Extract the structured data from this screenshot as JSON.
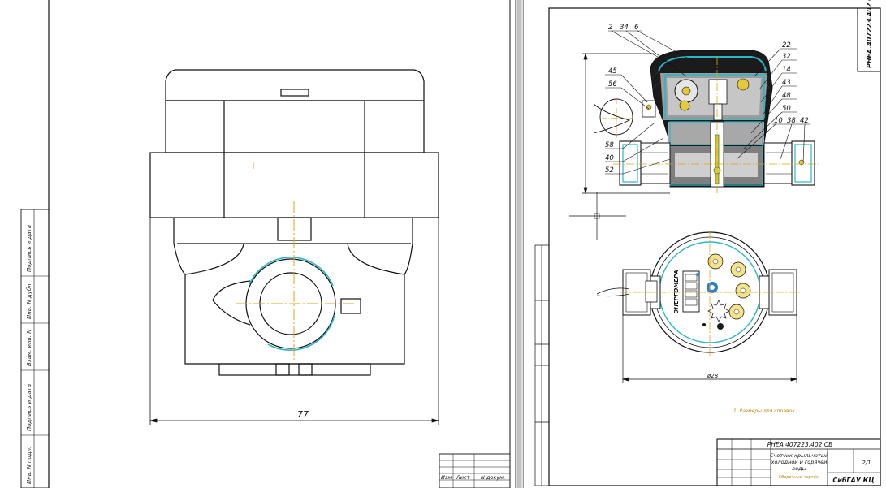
{
  "left_sheet": {
    "dimension": "77",
    "side_stamp": [
      "Подпись и дата",
      "Инв. N дубл.",
      "Взам. инв. N",
      "Подпись и дата",
      "Инв. N подл."
    ],
    "title_cells": [
      "Изм",
      "Лист",
      "N докум."
    ]
  },
  "right_sheet": {
    "doc_code_vertical": "РНЕА.407223.402 СБ",
    "callouts_top": [
      "2",
      "34",
      "6"
    ],
    "callouts_right": [
      "22",
      "32",
      "14",
      "43",
      "48",
      "50",
      "10",
      "38",
      "42"
    ],
    "callouts_left": [
      "45",
      "56",
      "58",
      "40",
      "52"
    ],
    "dimension_bottom": "ø28",
    "brand_vertical": "ЭНЕРГОМЕРА",
    "note": "1. Размеры для справок.",
    "title_block": {
      "code": "РНЕА.407223.402 СБ",
      "name_line1": "Счетчик крыльчатый",
      "name_line2": "холодной и горячей",
      "name_line3": "воды",
      "subtitle": "Сборочный чертёж",
      "sheet": "2/1",
      "org": "СибГАУ КЦ"
    }
  },
  "colors": {
    "outline": "#111111",
    "center": "#e0a21a",
    "cyan": "#2bb6c8",
    "section_fill": "#b9b9b9",
    "yellow": "#e6c93a"
  }
}
